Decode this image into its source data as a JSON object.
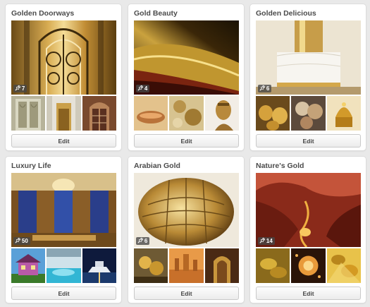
{
  "edit_label": "Edit",
  "boards": [
    {
      "title": "Golden Doorways",
      "pin_count": "7"
    },
    {
      "title": "Gold Beauty",
      "pin_count": "4"
    },
    {
      "title": "Golden Delicious",
      "pin_count": "6"
    },
    {
      "title": "Luxury Life",
      "pin_count": "50"
    },
    {
      "title": "Arabian Gold",
      "pin_count": "6"
    },
    {
      "title": "Nature's Gold",
      "pin_count": "14"
    }
  ],
  "icons": {
    "pin": "pushpin-icon"
  },
  "colors": {
    "page_bg": "#e9e9e9",
    "card_bg": "#ffffff",
    "title_text": "#4b4b4b"
  }
}
